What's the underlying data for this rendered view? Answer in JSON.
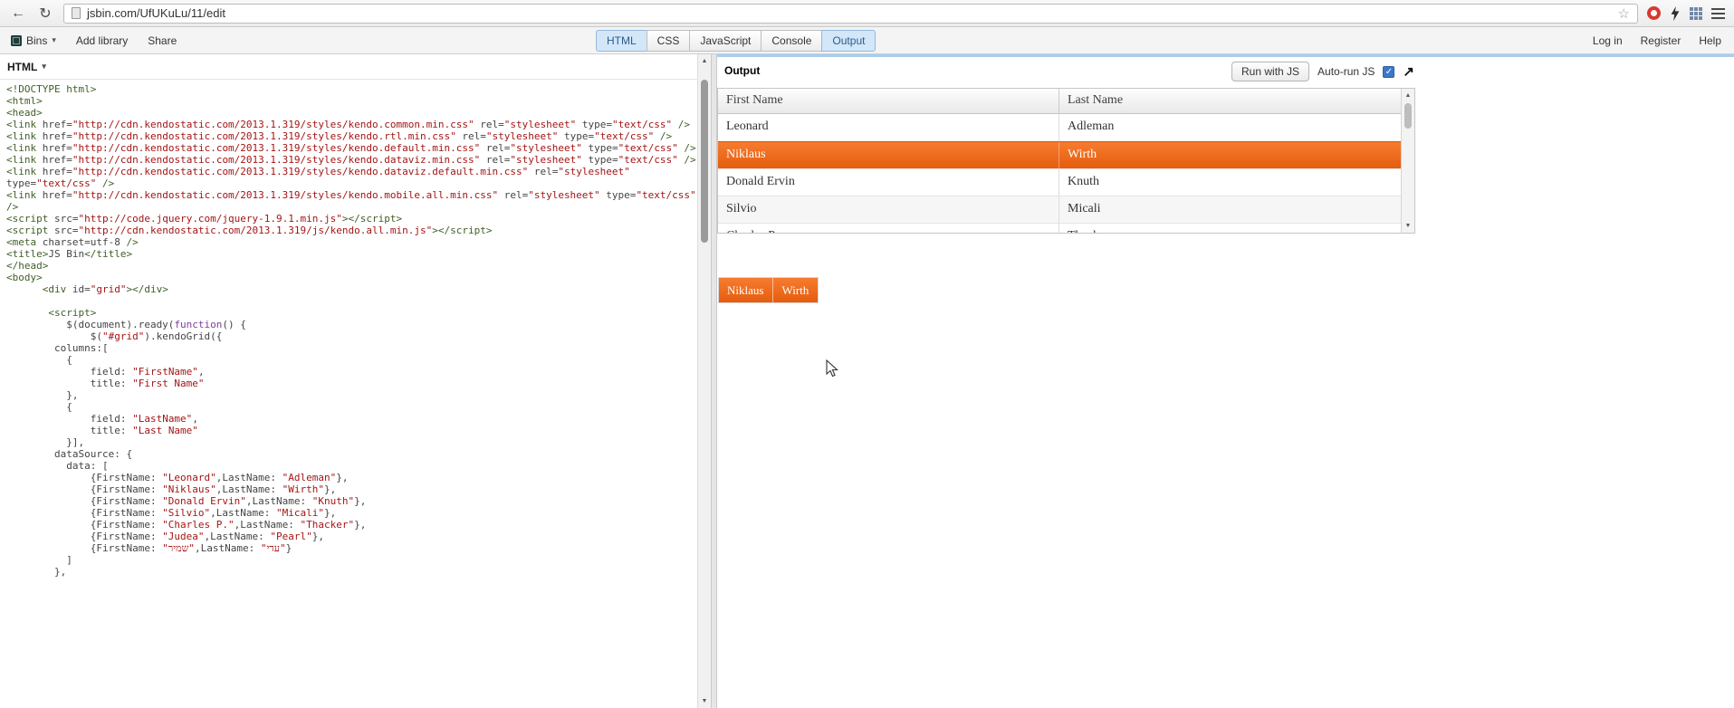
{
  "browser": {
    "url": "jsbin.com/UfUKuLu/11/edit"
  },
  "jsbin_toolbar": {
    "menu_items": [
      "Bins",
      "Add library",
      "Share"
    ],
    "tabs": [
      {
        "label": "HTML",
        "active": true
      },
      {
        "label": "CSS",
        "active": false
      },
      {
        "label": "JavaScript",
        "active": false
      },
      {
        "label": "Console",
        "active": false
      },
      {
        "label": "Output",
        "active": true
      }
    ],
    "account_links": [
      "Log in",
      "Register",
      "Help"
    ]
  },
  "editor": {
    "panel_title": "HTML",
    "lines": [
      [
        [
          "t",
          "<!DOCTYPE html>"
        ]
      ],
      [
        [
          "t",
          "<html>"
        ]
      ],
      [
        [
          "t",
          "<head>"
        ]
      ],
      [
        [
          "t",
          "<link"
        ],
        [
          "d",
          " href="
        ],
        [
          "s",
          "\"http://cdn.kendostatic.com/2013.1.319/styles/kendo.common.min.css\""
        ],
        [
          "d",
          " rel="
        ],
        [
          "s",
          "\"stylesheet\""
        ],
        [
          "d",
          " type="
        ],
        [
          "s",
          "\"text/css\""
        ],
        [
          "t",
          " />"
        ]
      ],
      [
        [
          "t",
          "<link"
        ],
        [
          "d",
          " href="
        ],
        [
          "s",
          "\"http://cdn.kendostatic.com/2013.1.319/styles/kendo.rtl.min.css\""
        ],
        [
          "d",
          " rel="
        ],
        [
          "s",
          "\"stylesheet\""
        ],
        [
          "d",
          " type="
        ],
        [
          "s",
          "\"text/css\""
        ],
        [
          "t",
          " />"
        ]
      ],
      [
        [
          "t",
          "<link"
        ],
        [
          "d",
          " href="
        ],
        [
          "s",
          "\"http://cdn.kendostatic.com/2013.1.319/styles/kendo.default.min.css\""
        ],
        [
          "d",
          " rel="
        ],
        [
          "s",
          "\"stylesheet\""
        ],
        [
          "d",
          " type="
        ],
        [
          "s",
          "\"text/css\""
        ],
        [
          "t",
          " />"
        ]
      ],
      [
        [
          "t",
          "<link"
        ],
        [
          "d",
          " href="
        ],
        [
          "s",
          "\"http://cdn.kendostatic.com/2013.1.319/styles/kendo.dataviz.min.css\""
        ],
        [
          "d",
          " rel="
        ],
        [
          "s",
          "\"stylesheet\""
        ],
        [
          "d",
          " type="
        ],
        [
          "s",
          "\"text/css\""
        ],
        [
          "t",
          " />"
        ]
      ],
      [
        [
          "t",
          "<link"
        ],
        [
          "d",
          " href="
        ],
        [
          "s",
          "\"http://cdn.kendostatic.com/2013.1.319/styles/kendo.dataviz.default.min.css\""
        ],
        [
          "d",
          " rel="
        ],
        [
          "s",
          "\"stylesheet\""
        ]
      ],
      [
        [
          "d",
          "type="
        ],
        [
          "s",
          "\"text/css\""
        ],
        [
          "t",
          " />"
        ]
      ],
      [
        [
          "t",
          "<link"
        ],
        [
          "d",
          " href="
        ],
        [
          "s",
          "\"http://cdn.kendostatic.com/2013.1.319/styles/kendo.mobile.all.min.css\""
        ],
        [
          "d",
          " rel="
        ],
        [
          "s",
          "\"stylesheet\""
        ],
        [
          "d",
          " type="
        ],
        [
          "s",
          "\"text/css\""
        ]
      ],
      [
        [
          "t",
          "/>"
        ]
      ],
      [
        [
          "t",
          "<script"
        ],
        [
          "d",
          " src="
        ],
        [
          "s",
          "\"http://code.jquery.com/jquery-1.9.1.min.js\""
        ],
        [
          "t",
          "></script>"
        ]
      ],
      [
        [
          "t",
          "<script"
        ],
        [
          "d",
          " src="
        ],
        [
          "s",
          "\"http://cdn.kendostatic.com/2013.1.319/js/kendo.all.min.js\""
        ],
        [
          "t",
          "></script>"
        ]
      ],
      [
        [
          "t",
          "<meta"
        ],
        [
          "d",
          " charset=utf-8 "
        ],
        [
          "t",
          "/>"
        ]
      ],
      [
        [
          "t",
          "<title>"
        ],
        [
          "d",
          "JS Bin"
        ],
        [
          "t",
          "</title>"
        ]
      ],
      [
        [
          "t",
          "</head>"
        ]
      ],
      [
        [
          "t",
          "<body>"
        ]
      ],
      [
        [
          "d",
          "      "
        ],
        [
          "t",
          "<div"
        ],
        [
          "d",
          " id="
        ],
        [
          "s",
          "\"grid\""
        ],
        [
          "t",
          "></div>"
        ]
      ],
      [],
      [
        [
          "d",
          "       "
        ],
        [
          "t",
          "<script>"
        ]
      ],
      [
        [
          "d",
          "          $(document).ready("
        ],
        [
          "k",
          "function"
        ],
        [
          "d",
          "() {"
        ]
      ],
      [
        [
          "d",
          "              $("
        ],
        [
          "s",
          "\"#grid\""
        ],
        [
          "d",
          ").kendoGrid({"
        ]
      ],
      [
        [
          "d",
          "        columns:["
        ]
      ],
      [
        [
          "d",
          "          {"
        ]
      ],
      [
        [
          "d",
          "              field: "
        ],
        [
          "s",
          "\"FirstName\""
        ],
        [
          "d",
          ","
        ]
      ],
      [
        [
          "d",
          "              title: "
        ],
        [
          "s",
          "\"First Name\""
        ]
      ],
      [
        [
          "d",
          "          },"
        ]
      ],
      [
        [
          "d",
          "          {"
        ]
      ],
      [
        [
          "d",
          "              field: "
        ],
        [
          "s",
          "\"LastName\""
        ],
        [
          "d",
          ","
        ]
      ],
      [
        [
          "d",
          "              title: "
        ],
        [
          "s",
          "\"Last Name\""
        ]
      ],
      [
        [
          "d",
          "          }],"
        ]
      ],
      [
        [
          "d",
          "        dataSource: {"
        ]
      ],
      [
        [
          "d",
          "          data: ["
        ]
      ],
      [
        [
          "d",
          "              {FirstName: "
        ],
        [
          "s",
          "\"Leonard\""
        ],
        [
          "d",
          ",LastName: "
        ],
        [
          "s",
          "\"Adleman\""
        ],
        [
          "d",
          "},"
        ]
      ],
      [
        [
          "d",
          "              {FirstName: "
        ],
        [
          "s",
          "\"Niklaus\""
        ],
        [
          "d",
          ",LastName: "
        ],
        [
          "s",
          "\"Wirth\""
        ],
        [
          "d",
          "},"
        ]
      ],
      [
        [
          "d",
          "              {FirstName: "
        ],
        [
          "s",
          "\"Donald Ervin\""
        ],
        [
          "d",
          ",LastName: "
        ],
        [
          "s",
          "\"Knuth\""
        ],
        [
          "d",
          "},"
        ]
      ],
      [
        [
          "d",
          "              {FirstName: "
        ],
        [
          "s",
          "\"Silvio\""
        ],
        [
          "d",
          ",LastName: "
        ],
        [
          "s",
          "\"Micali\""
        ],
        [
          "d",
          "},"
        ]
      ],
      [
        [
          "d",
          "              {FirstName: "
        ],
        [
          "s",
          "\"Charles P.\""
        ],
        [
          "d",
          ",LastName: "
        ],
        [
          "s",
          "\"Thacker\""
        ],
        [
          "d",
          "},"
        ]
      ],
      [
        [
          "d",
          "              {FirstName: "
        ],
        [
          "s",
          "\"Judea\""
        ],
        [
          "d",
          ",LastName: "
        ],
        [
          "s",
          "\"Pearl\""
        ],
        [
          "d",
          "},"
        ]
      ],
      [
        [
          "d",
          "              {FirstName: "
        ],
        [
          "s",
          "\"שמיר\""
        ],
        [
          "d",
          ",LastName: "
        ],
        [
          "s",
          "\"עדי\""
        ],
        [
          "d",
          "}"
        ]
      ],
      [
        [
          "d",
          "          ]"
        ]
      ],
      [
        [
          "d",
          "        },"
        ]
      ]
    ]
  },
  "output": {
    "panel_title": "Output",
    "run_button": "Run with JS",
    "autorun_label": "Auto-run JS",
    "autorun_checked": true,
    "accent_orange": "#ee671b",
    "grid": {
      "columns": [
        "First Name",
        "Last Name"
      ],
      "rows": [
        {
          "first": "Leonard",
          "last": "Adleman",
          "selected": false
        },
        {
          "first": "Niklaus",
          "last": "Wirth",
          "selected": true
        },
        {
          "first": "Donald Ervin",
          "last": "Knuth",
          "selected": false
        },
        {
          "first": "Silvio",
          "last": "Micali",
          "selected": false
        },
        {
          "first": "Charles P.",
          "last": "Thacker",
          "selected": false
        }
      ]
    },
    "selection_chip": [
      "Niklaus",
      "Wirth"
    ]
  }
}
